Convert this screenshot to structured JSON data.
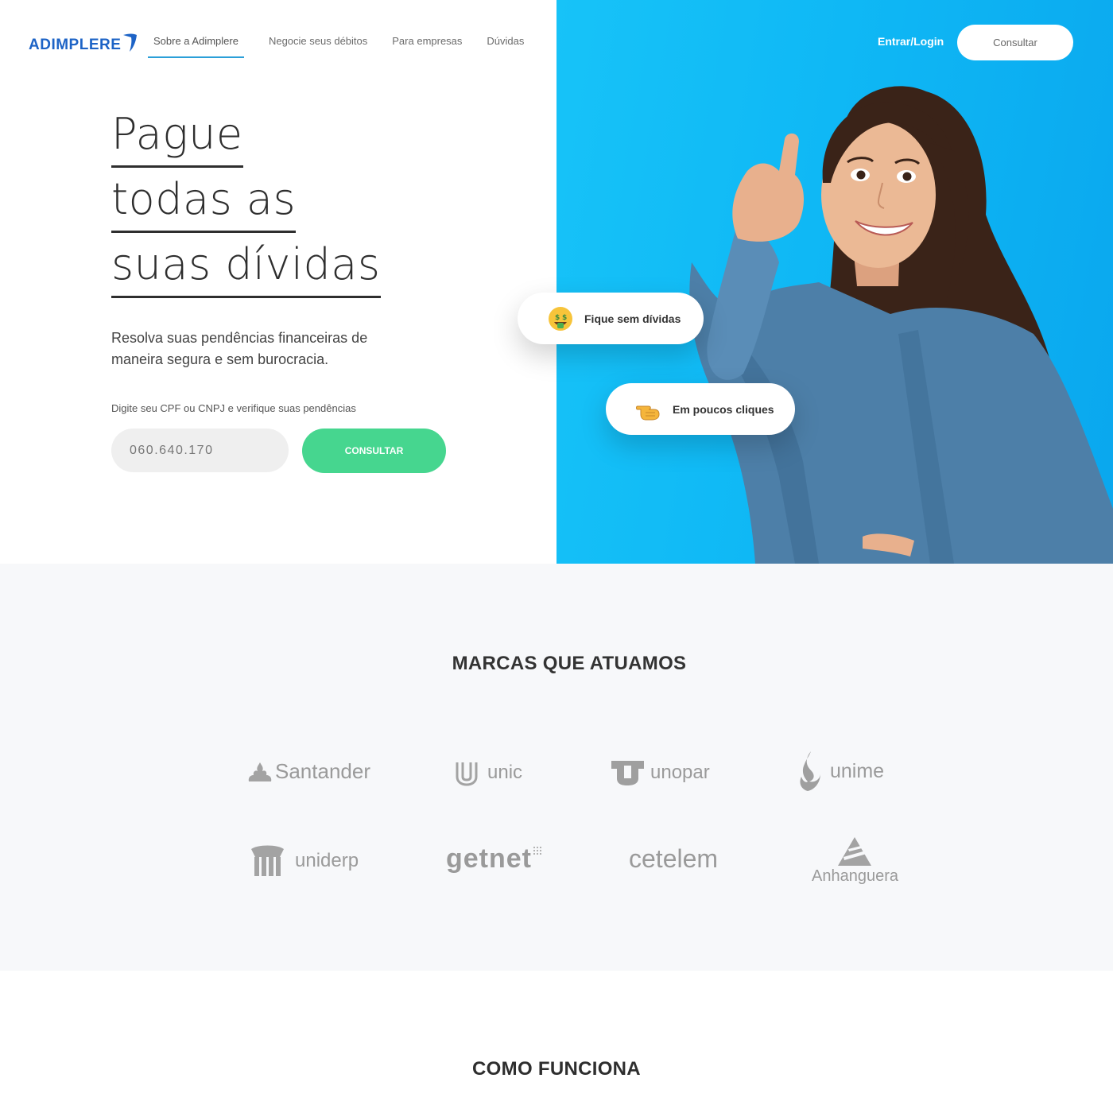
{
  "header": {
    "logo_text": "ADIMPLERE",
    "nav": [
      {
        "label": "Sobre a Adimplere",
        "active": true
      },
      {
        "label": "Negocie seus débitos",
        "active": false
      },
      {
        "label": "Para empresas",
        "active": false
      },
      {
        "label": "Dúvidas",
        "active": false
      }
    ],
    "login_label": "Entrar/Login",
    "consult_label": "Consultar"
  },
  "hero": {
    "headline_lines": [
      "Pague",
      "todas as",
      "suas dívidas"
    ],
    "subtitle": "Resolva suas pendências financeiras de maneira segura e sem burocracia.",
    "cpf_label": "Digite seu CPF ou CNPJ e verifique suas pendências",
    "cpf_value": "060.640.170",
    "consult_button": "CONSULTAR",
    "pills": [
      {
        "label": "Fique sem dívidas",
        "icon": "money-mouth-emoji-icon"
      },
      {
        "label": "Em poucos cliques",
        "icon": "pointing-hand-emoji-icon"
      }
    ],
    "accent_color": "#46d68f",
    "background_color": "#12bcf6"
  },
  "brands": {
    "title": "MARCAS QUE ATUAMOS",
    "items": [
      {
        "name": "Santander",
        "icon": "santander-flame-icon"
      },
      {
        "name": "unic",
        "icon": "unic-u-icon"
      },
      {
        "name": "unopar",
        "icon": "unopar-u-icon"
      },
      {
        "name": "unime",
        "icon": "unime-flame-icon"
      },
      {
        "name": "uniderp",
        "icon": "uniderp-columns-icon"
      },
      {
        "name": "getnet",
        "icon": "getnet-dots-icon"
      },
      {
        "name": "cetelem",
        "icon": "cetelem-icon"
      },
      {
        "name": "Anhanguera",
        "icon": "anhanguera-triangle-icon"
      }
    ]
  },
  "how_it_works": {
    "title": "COMO FUNCIONA"
  }
}
